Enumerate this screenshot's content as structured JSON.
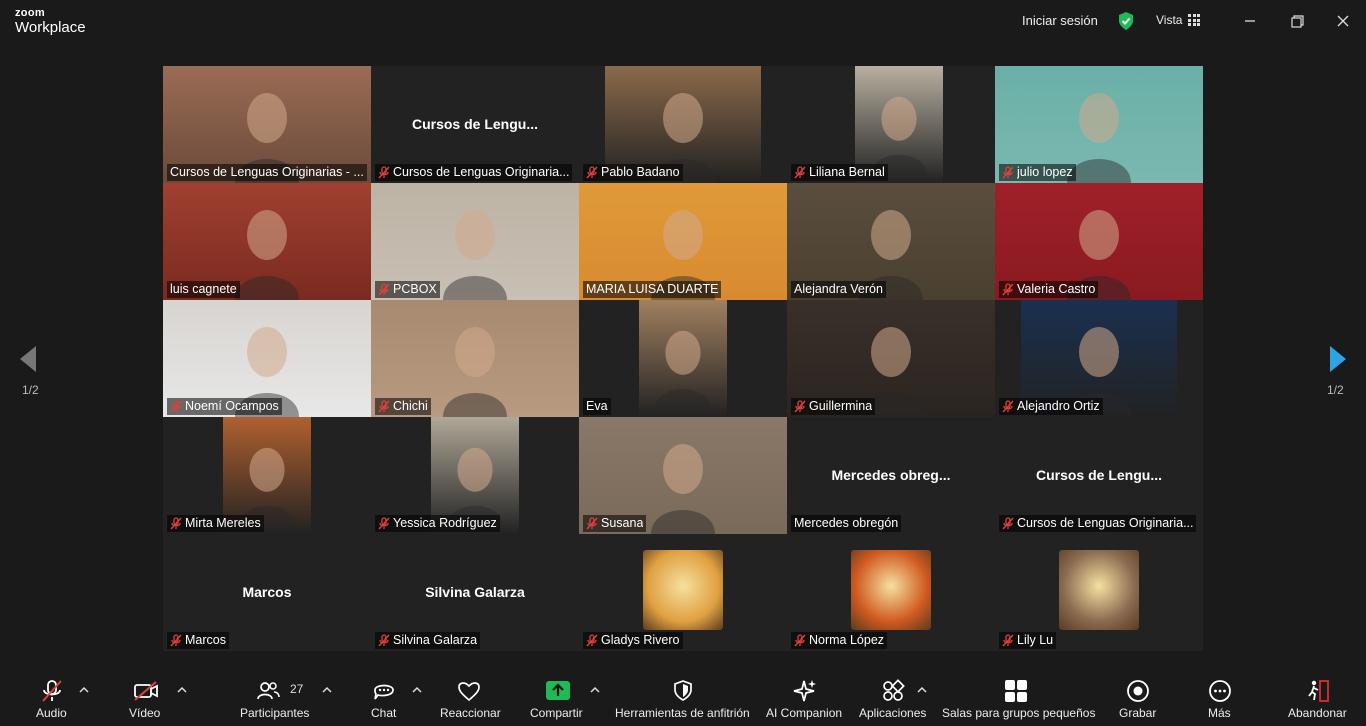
{
  "app": {
    "brand_top": "zoom",
    "brand_bottom": "Workplace"
  },
  "titlebar": {
    "signin": "Iniciar sesión",
    "view": "Vista"
  },
  "pagination": {
    "left": "1/2",
    "right": "1/2"
  },
  "tiles": [
    {
      "name": "Cursos de Lenguas Originarias - ...",
      "muted": false,
      "center": "",
      "bg": "#6b4a3a",
      "ph": "#9a6c54"
    },
    {
      "name": "Cursos de Lenguas Originaria...",
      "muted": true,
      "center": "Cursos de Lengu...",
      "bg": "#222222",
      "ph": ""
    },
    {
      "name": "Pablo Badano",
      "muted": true,
      "center": "",
      "bg": "#222222",
      "ph": "#8a6a4a"
    },
    {
      "name": "Liliana Bernal",
      "muted": true,
      "center": "",
      "bg": "#222222",
      "ph": "#b8b0a0"
    },
    {
      "name": "julio lopez",
      "muted": true,
      "center": "",
      "bg": "#7ab8b0",
      "ph": "#6ab0a8"
    },
    {
      "name": "luis cagnete",
      "muted": false,
      "center": "",
      "bg": "#7a2a20",
      "ph": "#a04030",
      "active": true
    },
    {
      "name": "PCBOX",
      "muted": true,
      "center": "",
      "bg": "#c8c0b4",
      "ph": "#bdb3a5"
    },
    {
      "name": "MARIA LUISA DUARTE",
      "muted": false,
      "center": "",
      "bg": "#d88a30",
      "ph": "#e09a38"
    },
    {
      "name": "Alejandra Verón",
      "muted": false,
      "center": "",
      "bg": "#4a4030",
      "ph": "#5a4e3e"
    },
    {
      "name": "Valeria Castro",
      "muted": true,
      "center": "",
      "bg": "#8a1a20",
      "ph": "#a0202a"
    },
    {
      "name": "Noemí Ocampos",
      "muted": true,
      "center": "",
      "bg": "#e8e8e8",
      "ph": "#d8d4d0"
    },
    {
      "name": "Chichi",
      "muted": true,
      "center": "",
      "bg": "#b89a80",
      "ph": "#a88a70"
    },
    {
      "name": "Eva",
      "muted": false,
      "center": "",
      "bg": "#222222",
      "ph": "#a08060"
    },
    {
      "name": "Guillermina",
      "muted": true,
      "center": "",
      "bg": "#2a2420",
      "ph": "#3a302a"
    },
    {
      "name": "Alejandro Ortiz",
      "muted": true,
      "center": "",
      "bg": "#222222",
      "ph": "#1a3050"
    },
    {
      "name": "Mirta Mereles",
      "muted": true,
      "center": "",
      "bg": "#222222",
      "ph": "#b06030"
    },
    {
      "name": "Yessica Rodríguez",
      "muted": true,
      "center": "",
      "bg": "#222222",
      "ph": "#b0a898"
    },
    {
      "name": "Susana",
      "muted": true,
      "center": "",
      "bg": "#7a6a5a",
      "ph": "#8a7868"
    },
    {
      "name": "Mercedes obregón",
      "muted": false,
      "center": "Mercedes obreg...",
      "bg": "#222222",
      "ph": ""
    },
    {
      "name": "Cursos de Lenguas Originaria...",
      "muted": true,
      "center": "Cursos de Lengu...",
      "bg": "#222222",
      "ph": ""
    },
    {
      "name": "Marcos",
      "muted": true,
      "center": "Marcos",
      "bg": "#222222",
      "ph": ""
    },
    {
      "name": "Silvina Galarza",
      "muted": true,
      "center": "Silvina Galarza",
      "bg": "#222222",
      "ph": ""
    },
    {
      "name": "Gladys Rivero",
      "muted": true,
      "center": "",
      "bg": "#222222",
      "ph": "",
      "avatar": "#e0a040"
    },
    {
      "name": "Norma López",
      "muted": true,
      "center": "",
      "bg": "#222222",
      "ph": "",
      "avatar": "#d05a20"
    },
    {
      "name": "Lily Lu",
      "muted": true,
      "center": "",
      "bg": "#222222",
      "ph": "",
      "avatar": "#8a6a50"
    }
  ],
  "toolbar": {
    "audio": "Audio",
    "video": "Vídeo",
    "participants": "Participantes",
    "participants_count": "27",
    "chat": "Chat",
    "react": "Reaccionar",
    "share": "Compartir",
    "host_tools": "Herramientas de anfitrión",
    "ai": "AI Companion",
    "apps": "Aplicaciones",
    "breakout": "Salas para grupos pequeños",
    "record": "Grabar",
    "more": "Más",
    "leave": "Abandonar"
  },
  "colors": {
    "active_speaker": "#2ea84a",
    "share_green": "#1fb955",
    "leave_red": "#e02b2b",
    "nav_blue": "#2ea4e8",
    "mute_red": "#e0403a"
  }
}
